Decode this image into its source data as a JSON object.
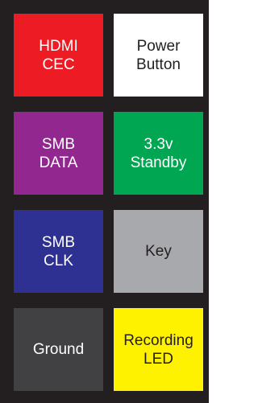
{
  "pins": [
    {
      "label": "HDMI\nCEC",
      "color": "#ed1c24",
      "text_color": "#ffffff"
    },
    {
      "label": "Power\nButton",
      "color": "#ffffff",
      "text_color": "#231f20"
    },
    {
      "label": "SMB\nDATA",
      "color": "#92278f",
      "text_color": "#ffffff"
    },
    {
      "label": "3.3v\nStandby",
      "color": "#00a651",
      "text_color": "#ffffff"
    },
    {
      "label": "SMB\nCLK",
      "color": "#2e3192",
      "text_color": "#ffffff"
    },
    {
      "label": "Key",
      "color": "#a7a9ac",
      "text_color": "#231f20"
    },
    {
      "label": "Ground",
      "color": "#414042",
      "text_color": "#ffffff"
    },
    {
      "label": "Recording\nLED",
      "color": "#fff200",
      "text_color": "#231f20"
    }
  ]
}
